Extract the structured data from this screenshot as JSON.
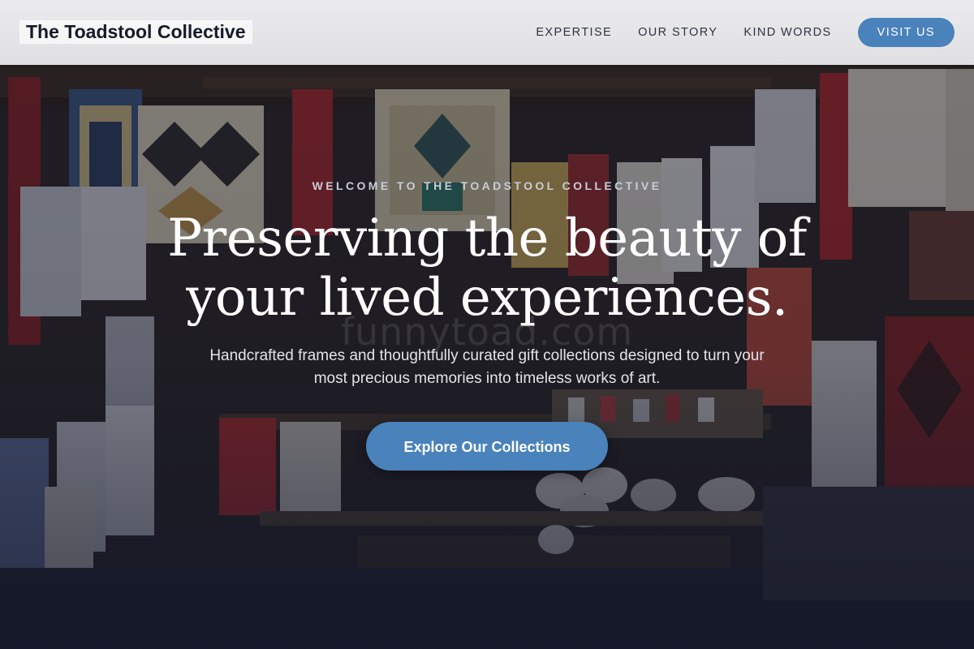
{
  "header": {
    "logo_text": "The Toadstool Collective",
    "nav": [
      {
        "label": "EXPERTISE"
      },
      {
        "label": "OUR STORY"
      },
      {
        "label": "KIND WORDS"
      }
    ],
    "cta_label": "VISIT US"
  },
  "hero": {
    "eyebrow": "WELCOME TO THE TOADSTOOL COLLECTIVE",
    "headline_line1": "Preserving the beauty of",
    "headline_line2": "your lived experiences.",
    "subheading_line1": "Handcrafted frames and thoughtfully curated gift collections designed to turn your",
    "subheading_line2": "most precious memories into timeless works of art.",
    "cta_label": "Explore Our Collections",
    "watermark": "funnytoad.com"
  },
  "colors": {
    "accent": "#4a82bb",
    "header_bg": "#e6e6e8",
    "headline": "#ffffff",
    "logo_text": "#161a28"
  }
}
